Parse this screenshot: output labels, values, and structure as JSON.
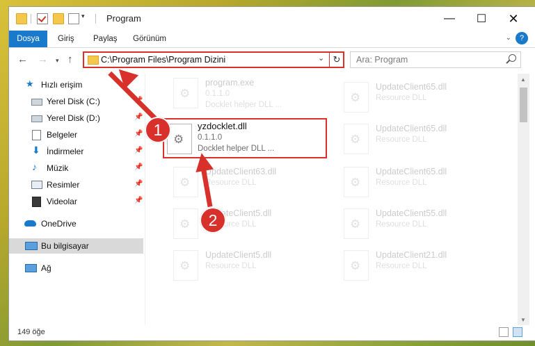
{
  "window": {
    "title": "Program",
    "quick_access": [
      "folder-icon",
      "properties-icon",
      "new-folder-icon",
      "customize-icon"
    ],
    "controls": [
      "minimize",
      "maximize",
      "close"
    ]
  },
  "ribbon": {
    "tabs": [
      {
        "label": "Dosya",
        "active": true
      },
      {
        "label": "Giriş",
        "active": false
      },
      {
        "label": "Paylaş",
        "active": false
      },
      {
        "label": "Görünüm",
        "active": false
      }
    ],
    "help": "?"
  },
  "navigation": {
    "address": "C:\\Program Files\\Program Dizini",
    "refresh": "↻",
    "search_placeholder": "Ara: Program"
  },
  "sidebar": {
    "items": [
      {
        "label": "Hızlı erişim",
        "icon": "star-icon",
        "pinned": false
      },
      {
        "label": "Yerel Disk (C:)",
        "icon": "drive-icon",
        "pinned": true
      },
      {
        "label": "Yerel Disk (D:)",
        "icon": "drive-icon",
        "pinned": true
      },
      {
        "label": "Belgeler",
        "icon": "documents-icon",
        "pinned": true
      },
      {
        "label": "İndirmeler",
        "icon": "download-icon",
        "pinned": true
      },
      {
        "label": "Müzik",
        "icon": "music-icon",
        "pinned": true
      },
      {
        "label": "Resimler",
        "icon": "pictures-icon",
        "pinned": true
      },
      {
        "label": "Videolar",
        "icon": "video-icon",
        "pinned": true
      },
      {
        "label": "OneDrive",
        "icon": "cloud-icon",
        "pinned": false
      },
      {
        "label": "Bu bilgisayar",
        "icon": "computer-icon",
        "pinned": false,
        "selected": true
      },
      {
        "label": "Ağ",
        "icon": "network-icon",
        "pinned": false
      }
    ]
  },
  "files": [
    {
      "name": "program.exe",
      "line2": "0.1.1.0",
      "line3": "Docklet helper DLL ...",
      "faded": true
    },
    {
      "name": "yzdocklet.dll",
      "line2": "0.1.1.0",
      "line3": "Docklet helper DLL ...",
      "faded": false
    },
    {
      "name": "UpdateClient63.dll",
      "line2": "Resource DLL",
      "line3": "",
      "faded": true
    },
    {
      "name": "UpdateClient5.dll",
      "line2": "Resource DLL",
      "line3": "",
      "faded": true
    },
    {
      "name": "UpdateClient5.dll",
      "line2": "Resource DLL",
      "line3": "",
      "faded": true
    },
    {
      "name": "UpdateClient65.dll",
      "line2": "Resource DLL",
      "line3": "",
      "faded": true
    },
    {
      "name": "UpdateClient65.dll",
      "line2": "Resource DLL",
      "line3": "",
      "faded": true
    },
    {
      "name": "UpdateClient65.dll",
      "line2": "Resource DLL",
      "line3": "",
      "faded": true
    },
    {
      "name": "UpdateClient55.dll",
      "line2": "Resource DLL",
      "line3": "",
      "faded": true
    },
    {
      "name": "UpdateClient21.dll",
      "line2": "Resource DLL",
      "line3": "",
      "faded": true
    }
  ],
  "status": {
    "count": "149 öğe"
  },
  "callouts": [
    "1",
    "2"
  ],
  "colors": {
    "accent": "#1979ca",
    "highlight": "#d8302b"
  }
}
